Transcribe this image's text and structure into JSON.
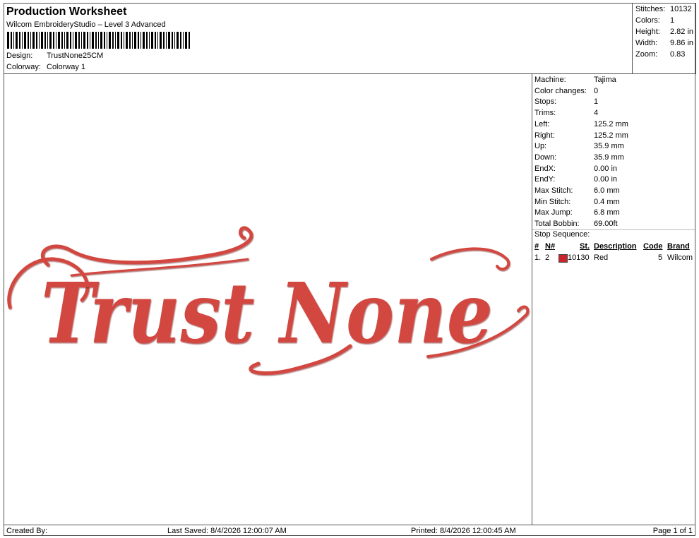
{
  "header": {
    "title": "Production Worksheet",
    "software": "Wilcom EmbroideryStudio – Level 3 Advanced",
    "design_label": "Design:",
    "design_value": "TrustNone25CM",
    "colorway_label": "Colorway:",
    "colorway_value": "Colorway 1"
  },
  "stats": {
    "stitches_label": "Stitches:",
    "stitches_value": "10132",
    "colors_label": "Colors:",
    "colors_value": "1",
    "height_label": "Height:",
    "height_value": "2.82 in",
    "width_label": "Width:",
    "width_value": "9.86 in",
    "zoom_label": "Zoom:",
    "zoom_value": "0.83"
  },
  "properties": [
    {
      "label": "Machine:",
      "value": "Tajima"
    },
    {
      "label": "Color changes:",
      "value": "0"
    },
    {
      "label": "Stops:",
      "value": "1"
    },
    {
      "label": "Trims:",
      "value": "4"
    },
    {
      "label": "Left:",
      "value": "125.2 mm"
    },
    {
      "label": "Right:",
      "value": "125.2 mm"
    },
    {
      "label": "Up:",
      "value": "35.9 mm"
    },
    {
      "label": "Down:",
      "value": "35.9 mm"
    },
    {
      "label": "EndX:",
      "value": "0.00 in"
    },
    {
      "label": "EndY:",
      "value": "0.00 in"
    },
    {
      "label": "Max Stitch:",
      "value": "6.0 mm"
    },
    {
      "label": "Min Stitch:",
      "value": "0.4 mm"
    },
    {
      "label": "Max Jump:",
      "value": "6.8 mm"
    },
    {
      "label": "Total Bobbin:",
      "value": "69.00ft"
    }
  ],
  "stop_sequence": {
    "title": "Stop Sequence:",
    "columns": {
      "num": "#",
      "n": "N#",
      "st": "St.",
      "description": "Description",
      "code": "Code",
      "brand": "Brand"
    },
    "rows": [
      {
        "num": "1.",
        "n": "2",
        "color": "#c8262b",
        "st": "10130",
        "description": "Red",
        "code": "5",
        "brand": "Wilcom"
      }
    ]
  },
  "design_preview": {
    "text": "Trust None",
    "thread_color": "#d2463f",
    "thread_shadow": "#a82a27"
  },
  "footer": {
    "created_by": "Created By:",
    "last_saved": "Last Saved: 8/4/2026 12:00:07 AM",
    "printed": "Printed: 8/4/2026 12:00:45 AM",
    "page": "Page 1 of 1"
  }
}
